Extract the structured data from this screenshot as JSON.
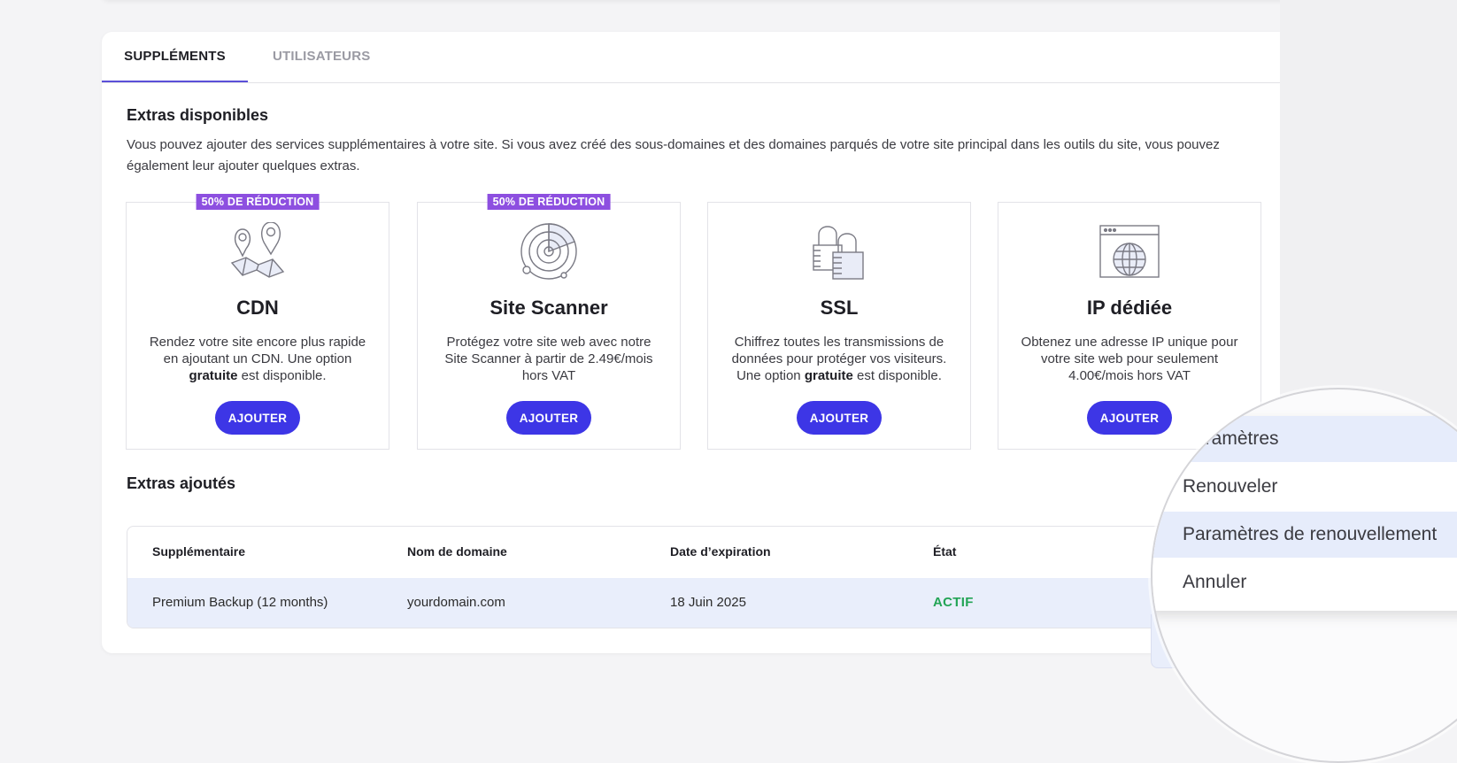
{
  "tabs": [
    {
      "label": "SUPPLÉMENTS",
      "active": true
    },
    {
      "label": "UTILISATEURS",
      "active": false
    }
  ],
  "available": {
    "title": "Extras disponibles",
    "description": "Vous pouvez ajouter des services supplémentaires à votre site. Si vous avez créé des sous-domaines et des domaines parqués de votre site principal dans les outils du site, vous pouvez également leur ajouter quelques extras."
  },
  "products": [
    {
      "badge": "50% DE RÉDUCTION",
      "icon": "map-pins-icon",
      "title": "CDN",
      "desc_pre": "Rendez votre site encore plus rapide en ajoutant un CDN. Une option ",
      "desc_bold": "gratuite",
      "desc_post": " est disponible.",
      "button": "AJOUTER"
    },
    {
      "badge": "50% DE RÉDUCTION",
      "icon": "radar-scanner-icon",
      "title": "Site Scanner",
      "desc_pre": "Protégez votre site web avec notre Site Scanner à partir de 2.49€/mois hors VAT",
      "desc_bold": "",
      "desc_post": "",
      "button": "AJOUTER"
    },
    {
      "badge": "",
      "icon": "padlocks-icon",
      "title": "SSL",
      "desc_pre": "Chiffrez toutes les transmissions de données pour protéger vos visiteurs. Une option ",
      "desc_bold": "gratuite",
      "desc_post": " est disponible.",
      "button": "AJOUTER"
    },
    {
      "badge": "",
      "icon": "browser-globe-icon",
      "title": "IP dédiée",
      "desc_pre": "Obtenez une adresse IP unique pour votre site web pour seulement 4.00€/mois hors VAT",
      "desc_bold": "",
      "desc_post": "",
      "button": "AJOUTER"
    }
  ],
  "added": {
    "title": "Extras ajoutés",
    "columns": [
      "Supplémentaire",
      "Nom de domaine",
      "Date d’expiration",
      "État"
    ],
    "rows": [
      {
        "addon": "Premium Backup (12 months)",
        "domain": "yourdomain.com",
        "expiry": "18 Juin 2025",
        "status": "ACTIF"
      }
    ]
  },
  "colors": {
    "accent": "#3d36e6",
    "badge": "#8d4fe0",
    "active_status": "#22a455",
    "row_highlight": "#e9eefb"
  },
  "context_menu": {
    "items": [
      {
        "label": "Paramètres",
        "highlighted": true
      },
      {
        "label": "Renouveler",
        "highlighted": false
      },
      {
        "label": "Paramètres de renouvellement",
        "highlighted": true
      },
      {
        "label": "Annuler",
        "highlighted": false
      }
    ]
  }
}
